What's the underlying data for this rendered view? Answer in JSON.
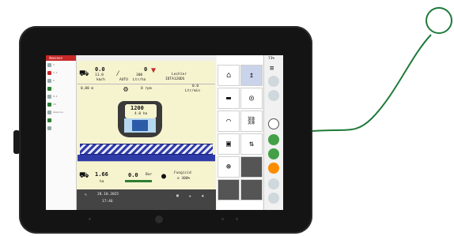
{
  "device": {
    "brand_label": "Amazone"
  },
  "status": {
    "signal": "73%"
  },
  "left_panel": {
    "rows": [
      "2",
      "3.5",
      "0",
      "-",
      "",
      "",
      "8.6",
      "19",
      "",
      "Amazone",
      "",
      "",
      "",
      "",
      ""
    ]
  },
  "main": {
    "speed_value": "0.0",
    "speed_sub": "11.0",
    "speed_unit": "km/h",
    "rate_value": "0",
    "rate_sub": "300",
    "rate_mode": "AUTO",
    "rate_unit": "Ltr/ha",
    "nozzle_brand": "Lechler",
    "nozzle_model": "IDTA120DS",
    "distance": "0,00 m",
    "rpm": "0 rpm",
    "flow_value": "0.0",
    "flow_unit": "Ltr/min",
    "tank_volume": "1200",
    "tank_area": "4.0 ha",
    "boom_width": "152",
    "area_value": "1.66",
    "area_unit": "ha",
    "pressure_value": "0.0",
    "pressure_unit": "Bar",
    "product_name": "Fungicid",
    "product_rate": "e 300%",
    "date": "28.10.2025",
    "time": "17:46"
  },
  "icons": {
    "house": "home-icon",
    "field": "field-icon",
    "boom": "boom-icon",
    "nozzle": "nozzle-icon",
    "steering": "steering-icon",
    "auto": "auto-icon"
  },
  "colors": {
    "screen_bg": "#f6f4cf",
    "accent_blue": "#2e3aa8",
    "brand_red": "#c62828",
    "cable": "#1f7a3a"
  }
}
